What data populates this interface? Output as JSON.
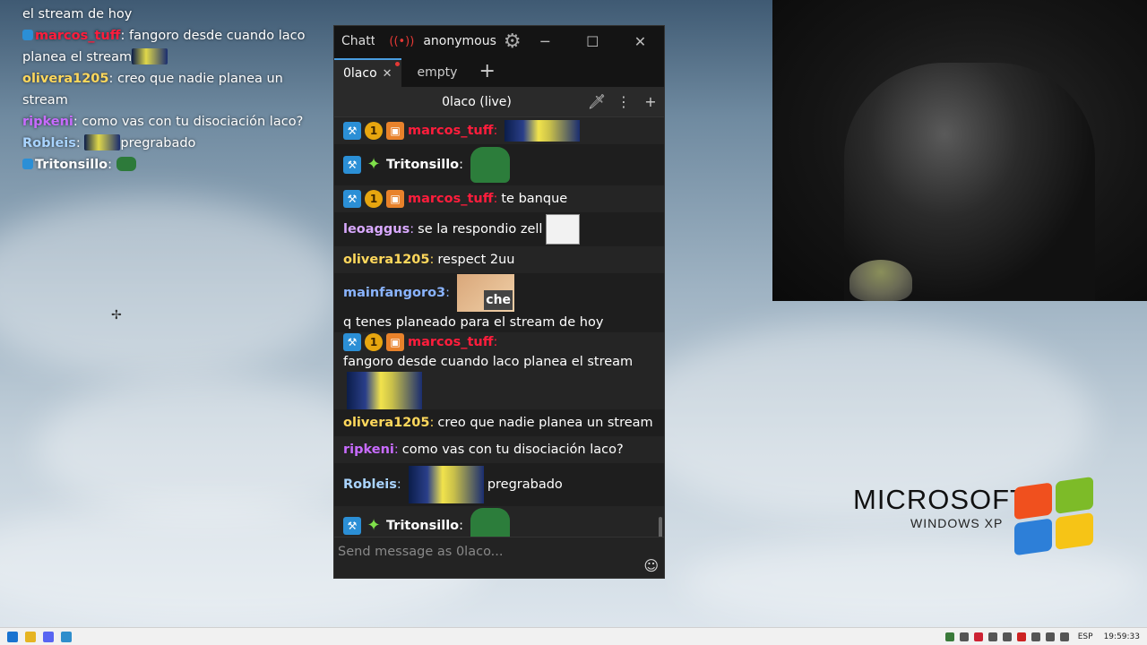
{
  "overlay": {
    "lines": [
      {
        "user": "",
        "text": "el stream de hoy",
        "color": "#ffffff"
      },
      {
        "user": "marcos_tuff",
        "text": "fangoro desde cuando laco planea el stream",
        "color": "#ff1d3c"
      },
      {
        "user": "olivera1205",
        "text": "creo que nadie planea un stream",
        "color": "#ffd85c"
      },
      {
        "user": "ripkeni",
        "text": "como vas con tu disociación laco?",
        "color": "#c86bff"
      },
      {
        "user": "Robleis",
        "text": "pregrabado",
        "color": "#a9d4ff"
      },
      {
        "user": "Tritonsillo",
        "text": "",
        "color": "#ffffff"
      }
    ]
  },
  "window": {
    "title": "Chatterino",
    "user": "anonymous",
    "tabs": [
      {
        "label": "0laco",
        "active": true
      },
      {
        "label": "empty",
        "active": false
      }
    ],
    "channel_header": "0laco (live)",
    "input_placeholder": "Send message as 0laco...",
    "messages": [
      {
        "user": "marcos_tuff",
        "color": "#ff1d3c",
        "badges": [
          "mod",
          "coin",
          "box"
        ],
        "text": "",
        "emote": "sponge"
      },
      {
        "user": "Tritonsillo",
        "color": "#ffffff",
        "badges": [
          "mod",
          "star"
        ],
        "text": "",
        "emote": "pepe"
      },
      {
        "user": "marcos_tuff",
        "color": "#ff1d3c",
        "badges": [
          "mod",
          "coin",
          "box"
        ],
        "text": "te banque",
        "emote": ""
      },
      {
        "user": "leoaggus",
        "color": "#d9a9ff",
        "badges": [],
        "text": "se la respondio zell",
        "emote": "meme"
      },
      {
        "user": "olivera1205",
        "color": "#ffd85c",
        "badges": [],
        "text": "respect 2uu",
        "emote": ""
      },
      {
        "user": "mainfangoro3",
        "color": "#8ab4ff",
        "badges": [],
        "text": "q tenes planeado para el stream de hoy",
        "emote": "cat"
      },
      {
        "user": "marcos_tuff",
        "color": "#ff1d3c",
        "badges": [
          "mod",
          "coin",
          "box"
        ],
        "text": "fangoro desde cuando laco planea el stream",
        "emote": "sponge-big"
      },
      {
        "user": "olivera1205",
        "color": "#ffd85c",
        "badges": [],
        "text": "creo que nadie planea un stream",
        "emote": ""
      },
      {
        "user": "ripkeni",
        "color": "#c86bff",
        "badges": [],
        "text": "como vas con tu disociación laco?",
        "emote": ""
      },
      {
        "user": "Robleis",
        "color": "#a9d4ff",
        "badges": [],
        "text": "pregrabado",
        "emote": "sponge-big-pre"
      },
      {
        "user": "Tritonsillo",
        "color": "#ffffff",
        "badges": [
          "mod",
          "star"
        ],
        "text": "",
        "emote": "pepe"
      }
    ]
  },
  "desktop": {
    "logo_text": "MICROSOFT",
    "logo_sub": "WINDOWS XP"
  },
  "taskbar": {
    "lang": "ESP",
    "time": "19:59:33"
  }
}
